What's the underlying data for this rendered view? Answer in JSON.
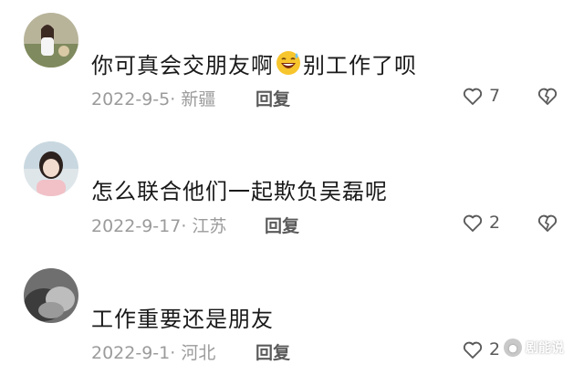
{
  "comments": [
    {
      "text_before": "你可真会交朋友啊",
      "emoji": "laughing-sweat-emoji",
      "text_after": "别工作了呗",
      "date": "2022-9-5",
      "location": "· 新疆",
      "reply_label": "回复",
      "likes": "7"
    },
    {
      "text_before": "怎么联合他们一起欺负吴磊呢",
      "text_after": "",
      "date": "2022-9-17",
      "location": "· 江苏",
      "reply_label": "回复",
      "likes": "2"
    },
    {
      "text_before": "工作重要还是朋友",
      "text_after": "",
      "date": "2022-9-1",
      "location": "· 河北",
      "reply_label": "回复",
      "likes": "2"
    }
  ],
  "watermark": {
    "text": "剧能说"
  },
  "colors": {
    "text": "#1a1a1a",
    "meta": "#9b9b9b",
    "icon": "#5a5a5a"
  }
}
